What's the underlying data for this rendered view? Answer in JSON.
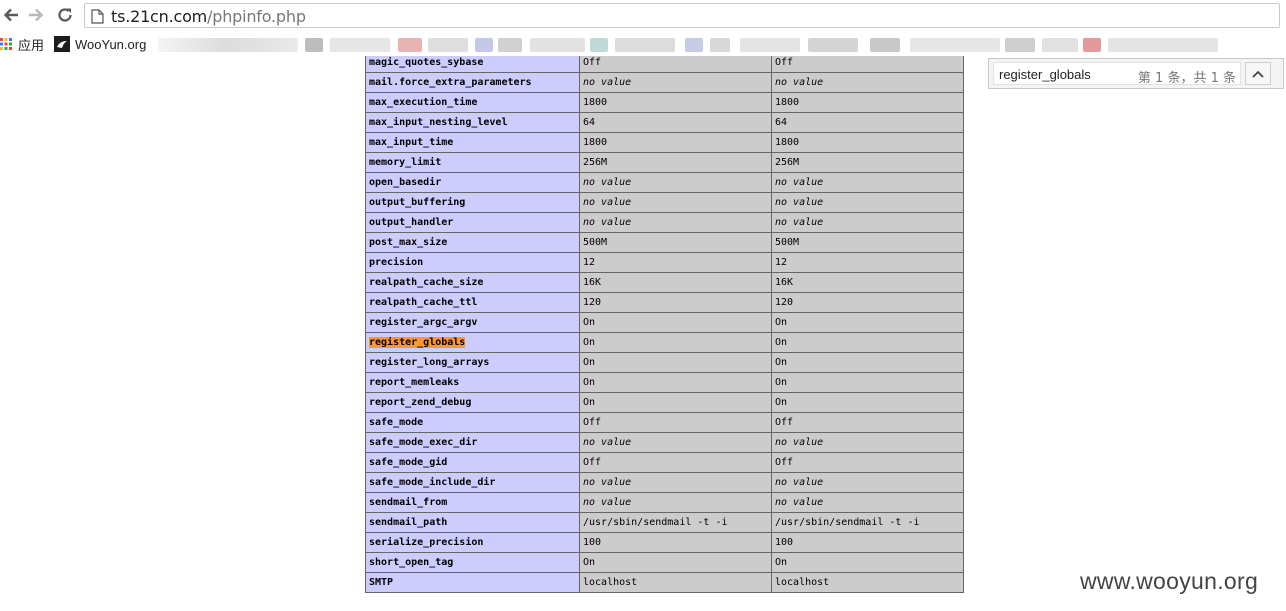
{
  "browser": {
    "url_host": "ts.21cn.com",
    "url_path": "/phpinfo.php",
    "bookmarks": [
      {
        "label": "应用",
        "icon": "apps-grid-icon"
      },
      {
        "label": "WooYun.org",
        "icon": "wooyun-favicon-icon"
      }
    ]
  },
  "find_bar": {
    "query": "register_globals",
    "match_count": "第 1 条，共 1 条"
  },
  "config_table": {
    "highlight_term": "register_globals",
    "rows": [
      {
        "directive": "magic_quotes_sybase",
        "local": "Off",
        "master": "Off"
      },
      {
        "directive": "mail.force_extra_parameters",
        "local": "no value",
        "master": "no value"
      },
      {
        "directive": "max_execution_time",
        "local": "1800",
        "master": "1800"
      },
      {
        "directive": "max_input_nesting_level",
        "local": "64",
        "master": "64"
      },
      {
        "directive": "max_input_time",
        "local": "1800",
        "master": "1800"
      },
      {
        "directive": "memory_limit",
        "local": "256M",
        "master": "256M"
      },
      {
        "directive": "open_basedir",
        "local": "no value",
        "master": "no value"
      },
      {
        "directive": "output_buffering",
        "local": "no value",
        "master": "no value"
      },
      {
        "directive": "output_handler",
        "local": "no value",
        "master": "no value"
      },
      {
        "directive": "post_max_size",
        "local": "500M",
        "master": "500M"
      },
      {
        "directive": "precision",
        "local": "12",
        "master": "12"
      },
      {
        "directive": "realpath_cache_size",
        "local": "16K",
        "master": "16K"
      },
      {
        "directive": "realpath_cache_ttl",
        "local": "120",
        "master": "120"
      },
      {
        "directive": "register_argc_argv",
        "local": "On",
        "master": "On"
      },
      {
        "directive": "register_globals",
        "local": "On",
        "master": "On"
      },
      {
        "directive": "register_long_arrays",
        "local": "On",
        "master": "On"
      },
      {
        "directive": "report_memleaks",
        "local": "On",
        "master": "On"
      },
      {
        "directive": "report_zend_debug",
        "local": "On",
        "master": "On"
      },
      {
        "directive": "safe_mode",
        "local": "Off",
        "master": "Off"
      },
      {
        "directive": "safe_mode_exec_dir",
        "local": "no value",
        "master": "no value"
      },
      {
        "directive": "safe_mode_gid",
        "local": "Off",
        "master": "Off"
      },
      {
        "directive": "safe_mode_include_dir",
        "local": "no value",
        "master": "no value"
      },
      {
        "directive": "sendmail_from",
        "local": "no value",
        "master": "no value"
      },
      {
        "directive": "sendmail_path",
        "local": "/usr/sbin/sendmail  -t  -i",
        "master": "/usr/sbin/sendmail  -t  -i"
      },
      {
        "directive": "serialize_precision",
        "local": "100",
        "master": "100"
      },
      {
        "directive": "short_open_tag",
        "local": "On",
        "master": "On"
      },
      {
        "directive": "SMTP",
        "local": "localhost",
        "master": "localhost"
      }
    ]
  },
  "watermark": "www.wooyun.org",
  "colors": {
    "directive_cell": "#ccccff",
    "value_cell": "#cccccc",
    "find_highlight": "#ff9632"
  }
}
